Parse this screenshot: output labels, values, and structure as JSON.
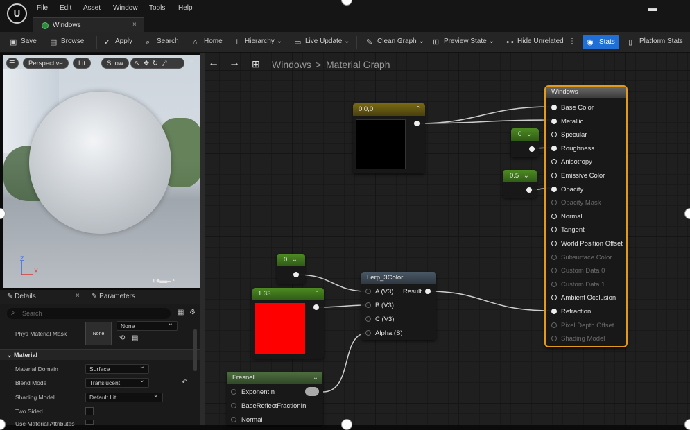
{
  "menu": {
    "items": [
      "File",
      "Edit",
      "Asset",
      "Window",
      "Tools",
      "Help"
    ]
  },
  "tab": {
    "title": "Windows",
    "close": "×"
  },
  "toolbar": {
    "save": "Save",
    "browse": "Browse",
    "apply": "Apply",
    "search": "Search",
    "home": "Home",
    "hierarchy": "Hierarchy",
    "live_update": "Live Update",
    "clean_graph": "Clean Graph",
    "preview_state": "Preview State",
    "hide_unrelated": "Hide Unrelated",
    "stats": "Stats",
    "platform_stats": "Platform Stats"
  },
  "viewport": {
    "perspective": "Perspective",
    "lit": "Lit",
    "show": "Show",
    "axis_z": "Z",
    "axis_x": "X"
  },
  "graph": {
    "breadcrumb_root": "Windows",
    "breadcrumb_sep": ">",
    "breadcrumb_child": "Material Graph"
  },
  "nodes": {
    "color_const": {
      "title": "0,0,0"
    },
    "scalar_0_top": {
      "value": "0"
    },
    "scalar_05": {
      "value": "0.5"
    },
    "scalar_0_left": {
      "value": "0"
    },
    "red_const": {
      "title": "1.33"
    },
    "lerp": {
      "title": "Lerp_3Color",
      "inputs": [
        "A (V3)",
        "B (V3)",
        "C (V3)",
        "Alpha (S)"
      ],
      "output": "Result"
    },
    "fresnel": {
      "title": "Fresnel",
      "inputs": [
        "ExponentIn",
        "BaseReflectFractionIn",
        "Normal"
      ]
    },
    "result": {
      "title": "Windows",
      "pins": [
        {
          "label": "Base Color",
          "state": "filled"
        },
        {
          "label": "Metallic",
          "state": "filled"
        },
        {
          "label": "Specular",
          "state": "open"
        },
        {
          "label": "Roughness",
          "state": "filled"
        },
        {
          "label": "Anisotropy",
          "state": "open"
        },
        {
          "label": "Emissive Color",
          "state": "open"
        },
        {
          "label": "Opacity",
          "state": "filled"
        },
        {
          "label": "Opacity Mask",
          "state": "disabled"
        },
        {
          "label": "Normal",
          "state": "open"
        },
        {
          "label": "Tangent",
          "state": "open"
        },
        {
          "label": "World Position Offset",
          "state": "open"
        },
        {
          "label": "Subsurface Color",
          "state": "disabled"
        },
        {
          "label": "Custom Data 0",
          "state": "disabled"
        },
        {
          "label": "Custom Data 1",
          "state": "disabled"
        },
        {
          "label": "Ambient Occlusion",
          "state": "open"
        },
        {
          "label": "Refraction",
          "state": "filled"
        },
        {
          "label": "Pixel Depth Offset",
          "state": "disabled"
        },
        {
          "label": "Shading Model",
          "state": "disabled"
        }
      ]
    }
  },
  "details": {
    "tab_details": "Details",
    "tab_close": "×",
    "tab_parameters": "Parameters",
    "search_placeholder": "Search",
    "phys_label": "Phys Material Mask",
    "phys_thumb": "None",
    "phys_value": "None",
    "section_material": "Material",
    "props": [
      {
        "label": "Material Domain",
        "value": "Surface"
      },
      {
        "label": "Blend Mode",
        "value": "Translucent"
      },
      {
        "label": "Shading Model",
        "value": "Default Lit"
      },
      {
        "label": "Two Sided",
        "value": ""
      },
      {
        "label": "Use Material Attributes",
        "value": ""
      }
    ]
  },
  "colors": {
    "accent_blue": "#1f6fd6",
    "result_border": "#e39a1c",
    "const_header": "#6d5f12",
    "scalar_header": "#3c6a1a",
    "red_swatch": "#ff0000",
    "lerp_header": "#3d4a57",
    "fresnel_header": "#3e5a33"
  }
}
